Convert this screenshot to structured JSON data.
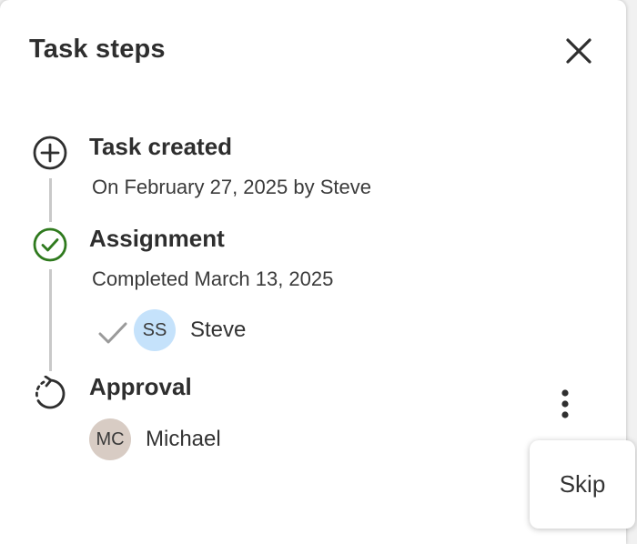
{
  "panel": {
    "title": "Task steps",
    "close_icon": "close-icon"
  },
  "steps": [
    {
      "title": "Task created",
      "subtitle": "On February 27, 2025 by Steve",
      "status": "created",
      "icon": "plus-circle-icon",
      "icon_color": "#2f2f2f"
    },
    {
      "title": "Assignment",
      "subtitle": "Completed March 13, 2025",
      "status": "completed",
      "icon": "check-circle-icon",
      "icon_color": "#2f7a1e",
      "assignees": [
        {
          "initials": "SS",
          "name": "Steve",
          "avatar_color": "#c5e2fb",
          "status_icon": "check-icon"
        }
      ]
    },
    {
      "title": "Approval",
      "status": "pending",
      "icon": "dashed-refresh-icon",
      "icon_color": "#2f2f2f",
      "assignees": [
        {
          "initials": "MC",
          "name": "Michael",
          "avatar_color": "#d8ccc4"
        }
      ],
      "more_icon": "more-vertical-icon",
      "menu": {
        "items": [
          "Skip"
        ]
      }
    }
  ],
  "colors": {
    "connector": "#c9c9c9",
    "completed": "#2f7a1e"
  }
}
